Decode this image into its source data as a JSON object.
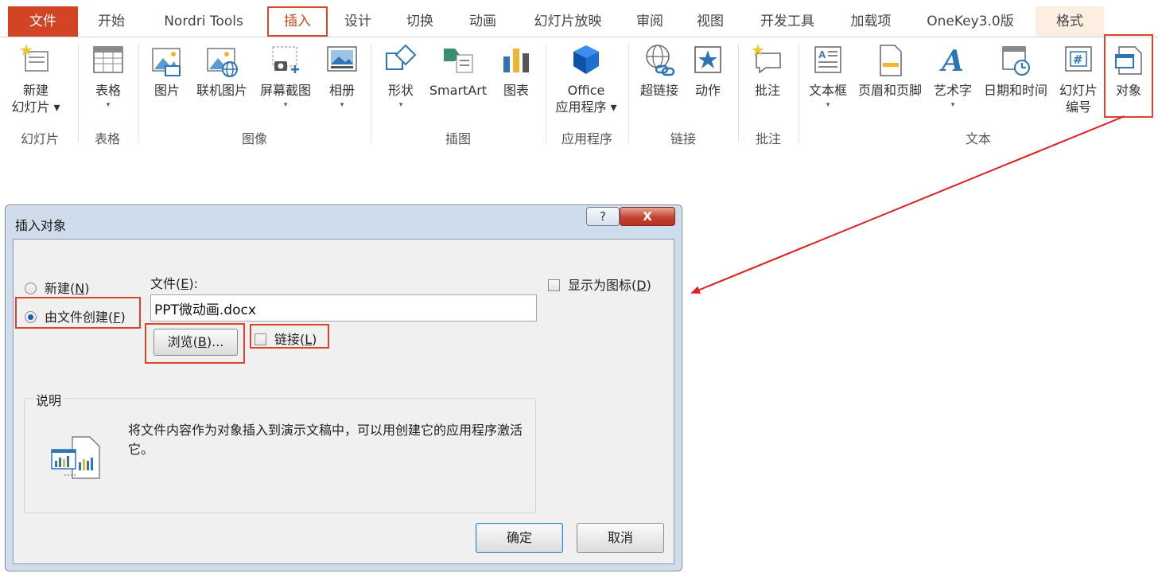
{
  "ribbon": {
    "tabs": [
      {
        "label": "文件",
        "kind": "file"
      },
      {
        "label": "开始"
      },
      {
        "label": "Nordri Tools"
      },
      {
        "label": "插入",
        "kind": "active"
      },
      {
        "label": "设计"
      },
      {
        "label": "切换"
      },
      {
        "label": "动画"
      },
      {
        "label": "幻灯片放映"
      },
      {
        "label": "审阅"
      },
      {
        "label": "视图"
      },
      {
        "label": "开发工具"
      },
      {
        "label": "加载项"
      },
      {
        "label": "OneKey3.0版"
      },
      {
        "label": "格式",
        "kind": "context"
      }
    ],
    "commands": {
      "new_slide": {
        "line1": "新建",
        "line2": "幻灯片 ▾"
      },
      "table": "表格",
      "picture": "图片",
      "online_picture": "联机图片",
      "screenshot": "屏幕截图",
      "album": "相册",
      "shapes": "形状",
      "smartart": "SmartArt",
      "chart": "图表",
      "office_apps": {
        "line1": "Office",
        "line2": "应用程序 ▾"
      },
      "hyperlink": "超链接",
      "action": "动作",
      "comment": "批注",
      "textbox": "文本框",
      "header_footer": "页眉和页脚",
      "wordart": "艺术字",
      "datetime": "日期和时间",
      "slide_number": {
        "line1": "幻灯片",
        "line2": "编号"
      },
      "object": "对象"
    },
    "groups": {
      "slides": "幻灯片",
      "tables": "表格",
      "images": "图像",
      "illustrations": "插图",
      "apps": "应用程序",
      "links": "链接",
      "comments": "批注",
      "text": "文本"
    }
  },
  "dialog": {
    "title": "插入对象",
    "help_label": "?",
    "close_label": "X",
    "create_new": {
      "label": "新建(",
      "key": "N",
      "close": ")"
    },
    "create_from_file": {
      "label": "由文件创建(",
      "key": "F",
      "close": ")"
    },
    "file_label": {
      "label": "文件(",
      "key": "E",
      "close": "):"
    },
    "file_value": "PPT微动画.docx",
    "browse": {
      "label": "浏览(",
      "key": "B",
      "close": ")..."
    },
    "link": {
      "label": "链接(",
      "key": "L",
      "close": ")"
    },
    "display_as_icon": {
      "label": "显示为图标(",
      "key": "D",
      "close": ")"
    },
    "description_title": "说明",
    "description": "将文件内容作为对象插入到演示文稿中，可以用创建它的应用程序激活它。",
    "ok": "确定",
    "cancel": "取消"
  },
  "colors": {
    "accent": "#d14524",
    "highlight": "#d9472b",
    "annotation_arrow": "#e02020"
  }
}
